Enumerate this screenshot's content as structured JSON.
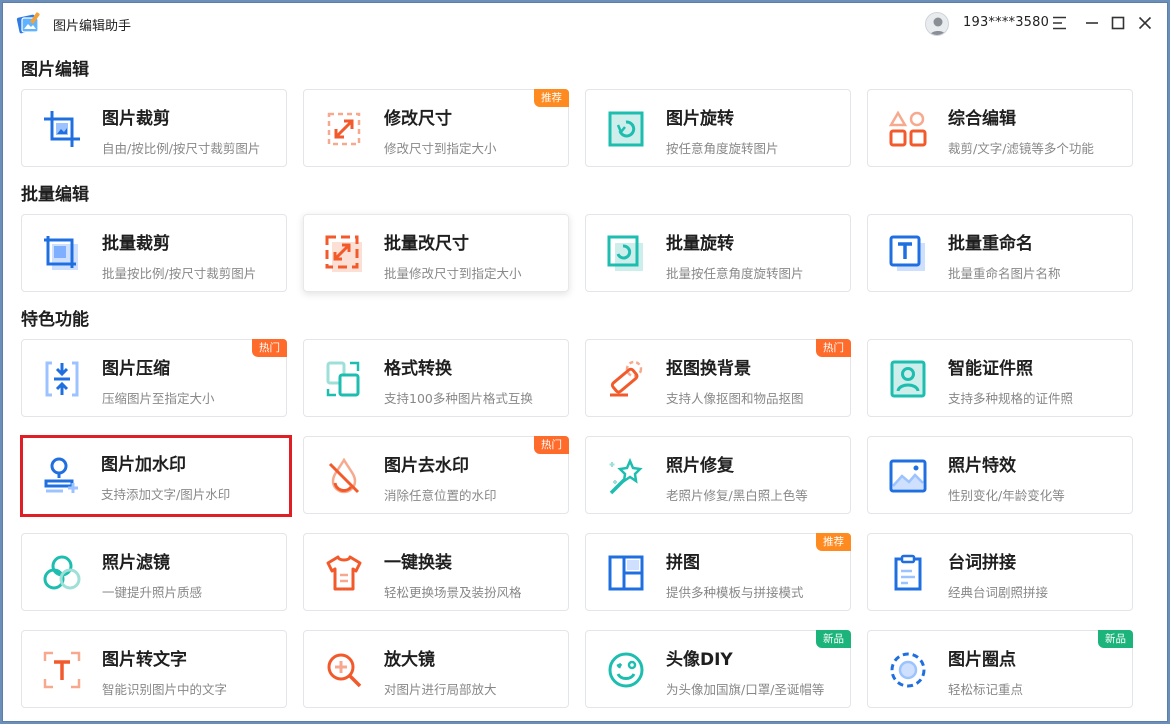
{
  "app": {
    "title": "图片编辑助手",
    "user_phone": "193****3580"
  },
  "sections": [
    {
      "title": "图片编辑"
    },
    {
      "title": "批量编辑"
    },
    {
      "title": "特色功能"
    }
  ],
  "cards": {
    "crop": {
      "title": "图片裁剪",
      "desc": "自由/按比例/按尺寸裁剪图片"
    },
    "resize": {
      "title": "修改尺寸",
      "desc": "修改尺寸到指定大小",
      "badge": "推荐"
    },
    "rotate": {
      "title": "图片旋转",
      "desc": "按任意角度旋转图片"
    },
    "multi_edit": {
      "title": "综合编辑",
      "desc": "裁剪/文字/滤镜等多个功能"
    },
    "batch_crop": {
      "title": "批量裁剪",
      "desc": "批量按比例/按尺寸裁剪图片"
    },
    "batch_resize": {
      "title": "批量改尺寸",
      "desc": "批量修改尺寸到指定大小"
    },
    "batch_rotate": {
      "title": "批量旋转",
      "desc": "批量按任意角度旋转图片"
    },
    "batch_rename": {
      "title": "批量重命名",
      "desc": "批量重命名图片名称"
    },
    "compress": {
      "title": "图片压缩",
      "desc": "压缩图片至指定大小",
      "badge": "热门"
    },
    "format": {
      "title": "格式转换",
      "desc": "支持100多种图片格式互换"
    },
    "cutout": {
      "title": "抠图换背景",
      "desc": "支持人像抠图和物品抠图",
      "badge": "热门"
    },
    "id_photo": {
      "title": "智能证件照",
      "desc": "支持多种规格的证件照"
    },
    "watermark_add": {
      "title": "图片加水印",
      "desc": "支持添加文字/图片水印"
    },
    "watermark_remove": {
      "title": "图片去水印",
      "desc": "消除任意位置的水印",
      "badge": "热门"
    },
    "repair": {
      "title": "照片修复",
      "desc": "老照片修复/黑白照上色等"
    },
    "effects": {
      "title": "照片特效",
      "desc": "性别变化/年龄变化等"
    },
    "filter": {
      "title": "照片滤镜",
      "desc": "一键提升照片质感"
    },
    "outfit": {
      "title": "一键换装",
      "desc": "轻松更换场景及装扮风格"
    },
    "collage": {
      "title": "拼图",
      "desc": "提供多种模板与拼接模式",
      "badge": "推荐"
    },
    "lines": {
      "title": "台词拼接",
      "desc": "经典台词剧照拼接"
    },
    "ocr": {
      "title": "图片转文字",
      "desc": "智能识别图片中的文字"
    },
    "magnifier": {
      "title": "放大镜",
      "desc": "对图片进行局部放大"
    },
    "avatar_diy": {
      "title": "头像DIY",
      "desc": "为头像加国旗/口罩/圣诞帽等",
      "badge": "新品"
    },
    "circle": {
      "title": "图片圈点",
      "desc": "轻松标记重点",
      "badge": "新品"
    }
  },
  "colors": {
    "blue": "#1f6fe0",
    "orange": "#f25a2c",
    "teal": "#1dbdb0",
    "highlight": "#e01e26",
    "badge_hot": "#ff6b2b",
    "badge_new": "#1cb47b"
  }
}
